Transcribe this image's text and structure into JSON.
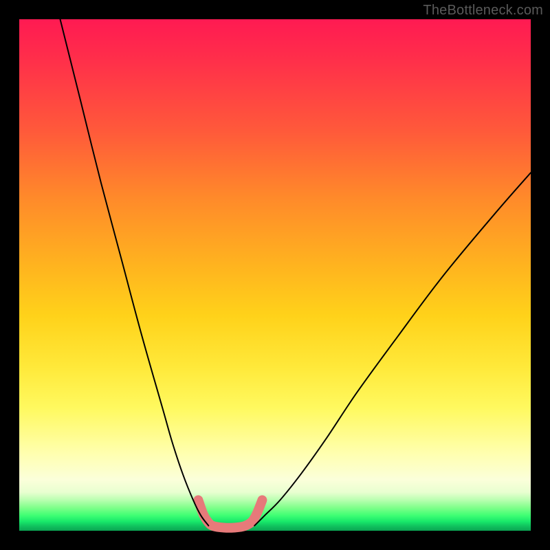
{
  "watermark": "TheBottleneck.com",
  "chart_data": {
    "type": "line",
    "title": "",
    "xlabel": "",
    "ylabel": "",
    "xlim": [
      0,
      100
    ],
    "ylim": [
      0,
      100
    ],
    "series": [
      {
        "name": "left-curve",
        "x": [
          8,
          12,
          16,
          20,
          24,
          28,
          30,
          32,
          34,
          35.5,
          37
        ],
        "y": [
          100,
          84,
          68,
          53,
          38,
          24,
          17,
          11,
          6,
          3,
          1
        ]
      },
      {
        "name": "right-curve",
        "x": [
          46,
          48,
          51,
          55,
          60,
          66,
          74,
          83,
          93,
          100
        ],
        "y": [
          1,
          3,
          6,
          11,
          18,
          27,
          38,
          50,
          62,
          70
        ]
      },
      {
        "name": "trough-marker",
        "x": [
          35,
          36,
          37,
          38,
          40,
          42,
          44,
          45.5,
          46.5,
          47.5
        ],
        "y": [
          6,
          3.2,
          1.6,
          0.9,
          0.6,
          0.6,
          0.9,
          1.8,
          3.5,
          6
        ]
      }
    ],
    "style": {
      "left-curve": {
        "stroke": "#000000",
        "width": 2
      },
      "right-curve": {
        "stroke": "#000000",
        "width": 2
      },
      "trough-marker": {
        "stroke": "#e77a7a",
        "width": 14,
        "linecap": "round"
      }
    }
  }
}
